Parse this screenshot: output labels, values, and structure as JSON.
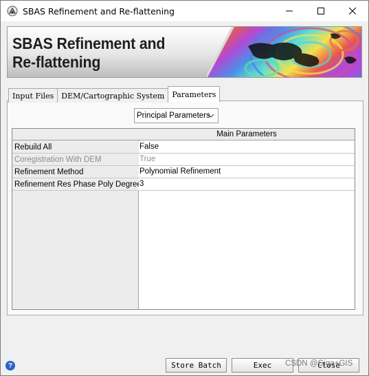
{
  "window": {
    "title": "SBAS Refinement and Re-flattening",
    "icon": "app-logo-icon",
    "controls": {
      "minimize": "minimize-icon",
      "maximize": "maximize-icon",
      "close": "close-icon"
    }
  },
  "banner": {
    "title": "SBAS Refinement and\nRe-flattening"
  },
  "tabs": [
    {
      "label": "Input Files",
      "active": false
    },
    {
      "label": "DEM/Cartographic System",
      "active": false
    },
    {
      "label": "Parameters",
      "active": true
    }
  ],
  "parameters": {
    "dropdown_value": "Principal Parameters",
    "table": {
      "column_header": "Main Parameters",
      "rows": [
        {
          "label": "Rebuild All",
          "value": "False",
          "enabled": true
        },
        {
          "label": "Coregistration With DEM",
          "value": "True",
          "enabled": false
        },
        {
          "label": "Refinement Method",
          "value": "Polynomial Refinement",
          "enabled": true
        },
        {
          "label": "Refinement Res Phase Poly Degree",
          "value": "3",
          "enabled": true
        }
      ]
    }
  },
  "footer": {
    "help_icon": "help-icon",
    "buttons": {
      "store_batch": "Store Batch",
      "exec": "Exec",
      "close": "Close"
    },
    "watermark": "CSDN @Giga+GIS"
  }
}
